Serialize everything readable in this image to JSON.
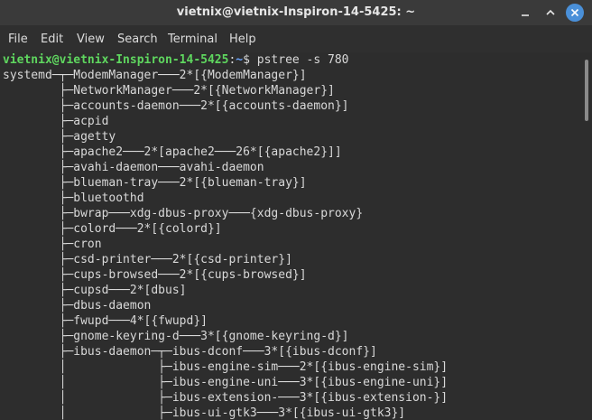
{
  "window": {
    "title": "vietnix@vietnix-Inspiron-14-5425: ~"
  },
  "controls": {
    "minimize_icon": "minimize-icon",
    "maximize_icon": "maximize-icon",
    "close_icon": "close-icon",
    "close_color": "#4a90d9"
  },
  "menu": {
    "items": [
      "File",
      "Edit",
      "View",
      "Search",
      "Terminal",
      "Help"
    ]
  },
  "prompt": {
    "user_host": "vietnix@vietnix-Inspiron-14-5425",
    "separator": ":",
    "path": "~",
    "symbol": "$ ",
    "command": "pstree -s 780"
  },
  "colors": {
    "prompt_user": "#5fd75f",
    "prompt_path": "#6aa5ff",
    "background": "#2d2d2d",
    "text": "#d9d9d9"
  },
  "output": [
    "systemd─┬─ModemManager───2*[{ModemManager}]",
    "        ├─NetworkManager───2*[{NetworkManager}]",
    "        ├─accounts-daemon───2*[{accounts-daemon}]",
    "        ├─acpid",
    "        ├─agetty",
    "        ├─apache2───2*[apache2───26*[{apache2}]]",
    "        ├─avahi-daemon───avahi-daemon",
    "        ├─blueman-tray───2*[{blueman-tray}]",
    "        ├─bluetoothd",
    "        ├─bwrap───xdg-dbus-proxy───{xdg-dbus-proxy}",
    "        ├─colord───2*[{colord}]",
    "        ├─cron",
    "        ├─csd-printer───2*[{csd-printer}]",
    "        ├─cups-browsed───2*[{cups-browsed}]",
    "        ├─cupsd───2*[dbus]",
    "        ├─dbus-daemon",
    "        ├─fwupd───4*[{fwupd}]",
    "        ├─gnome-keyring-d───3*[{gnome-keyring-d}]",
    "        ├─ibus-daemon─┬─ibus-dconf───3*[{ibus-dconf}]",
    "        │             ├─ibus-engine-sim───2*[{ibus-engine-sim}]",
    "        │             ├─ibus-engine-uni───3*[{ibus-engine-uni}]",
    "        │             ├─ibus-extension-───3*[{ibus-extension-}]",
    "        │             ├─ibus-ui-gtk3───3*[{ibus-ui-gtk3}]"
  ]
}
